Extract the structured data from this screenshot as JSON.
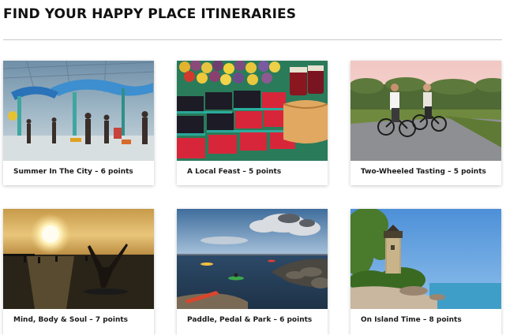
{
  "page": {
    "heading": "FIND YOUR HAPPY PLACE ITINERARIES"
  },
  "cards": [
    {
      "title": "Summer In The City – 6 points",
      "image": "indoor-waterpark-photo"
    },
    {
      "title": "A Local Feast – 5 points",
      "image": "market-berries-photo"
    },
    {
      "title": "Two-Wheeled Tasting – 5 points",
      "image": "vineyard-cyclists-photo"
    },
    {
      "title": "Mind, Body & Soul – 7 points",
      "image": "sunset-paddleboard-yoga-photo"
    },
    {
      "title": "Paddle, Pedal & Park – 6 points",
      "image": "lake-kayaks-photo"
    },
    {
      "title": "On Island Time – 8 points",
      "image": "island-lighthouse-photo"
    }
  ]
}
